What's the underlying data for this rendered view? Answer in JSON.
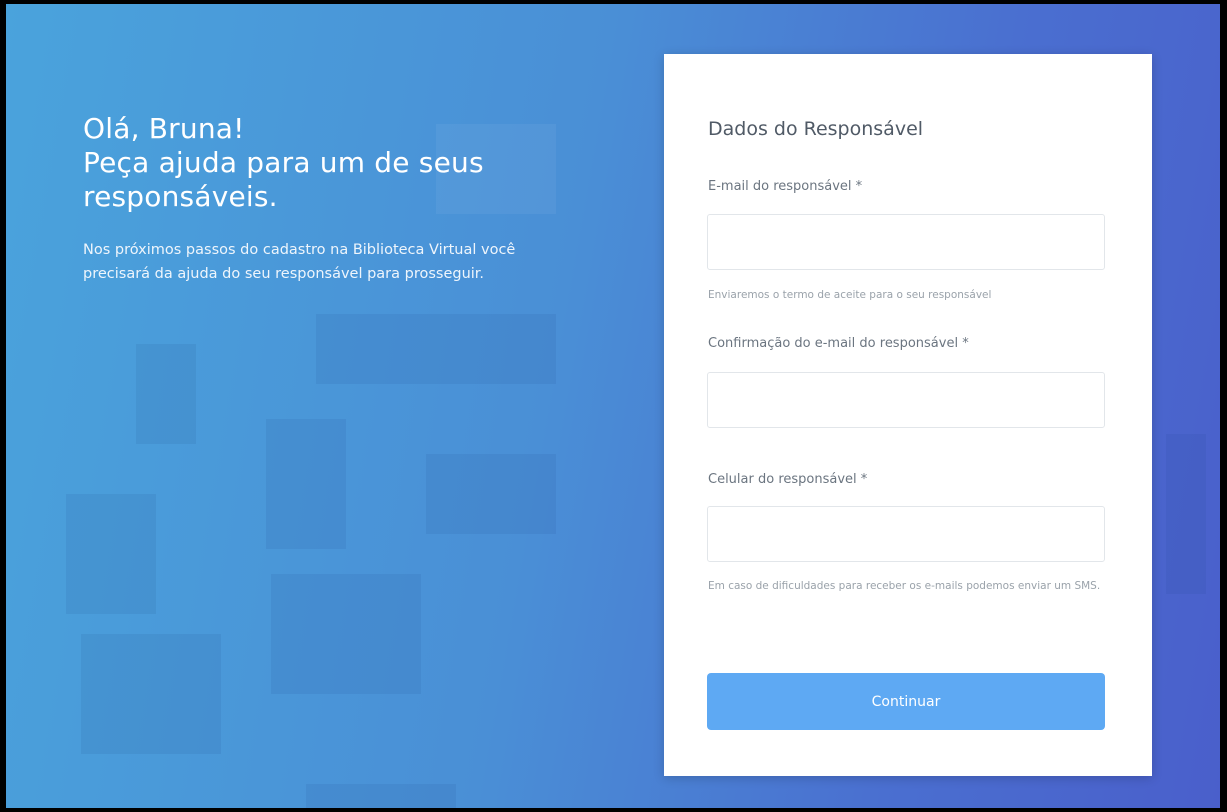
{
  "hero": {
    "greeting": "Olá, Bruna!",
    "headline_line2": "Peça ajuda para um de seus",
    "headline_line3": "responsáveis.",
    "description": "Nos próximos passos do cadastro na Biblioteca Virtual você precisará da ajuda do seu responsável para prosseguir."
  },
  "form": {
    "title": "Dados do Responsável",
    "email_label": "E-mail do responsável *",
    "email_value": "",
    "email_hint": "Enviaremos o termo de aceite para o seu responsável",
    "confirm_label": "Confirmação do e-mail do responsável *",
    "confirm_value": "",
    "phone_label": "Celular do responsável *",
    "phone_value": "",
    "phone_hint": "Em caso de dificuldades para receber os e-mails podemos enviar um SMS.",
    "submit_label": "Continuar"
  },
  "colors": {
    "background_start": "#4aa3dc",
    "background_end": "#4a5fcb",
    "button": "#5ea9f3",
    "card": "#ffffff"
  }
}
